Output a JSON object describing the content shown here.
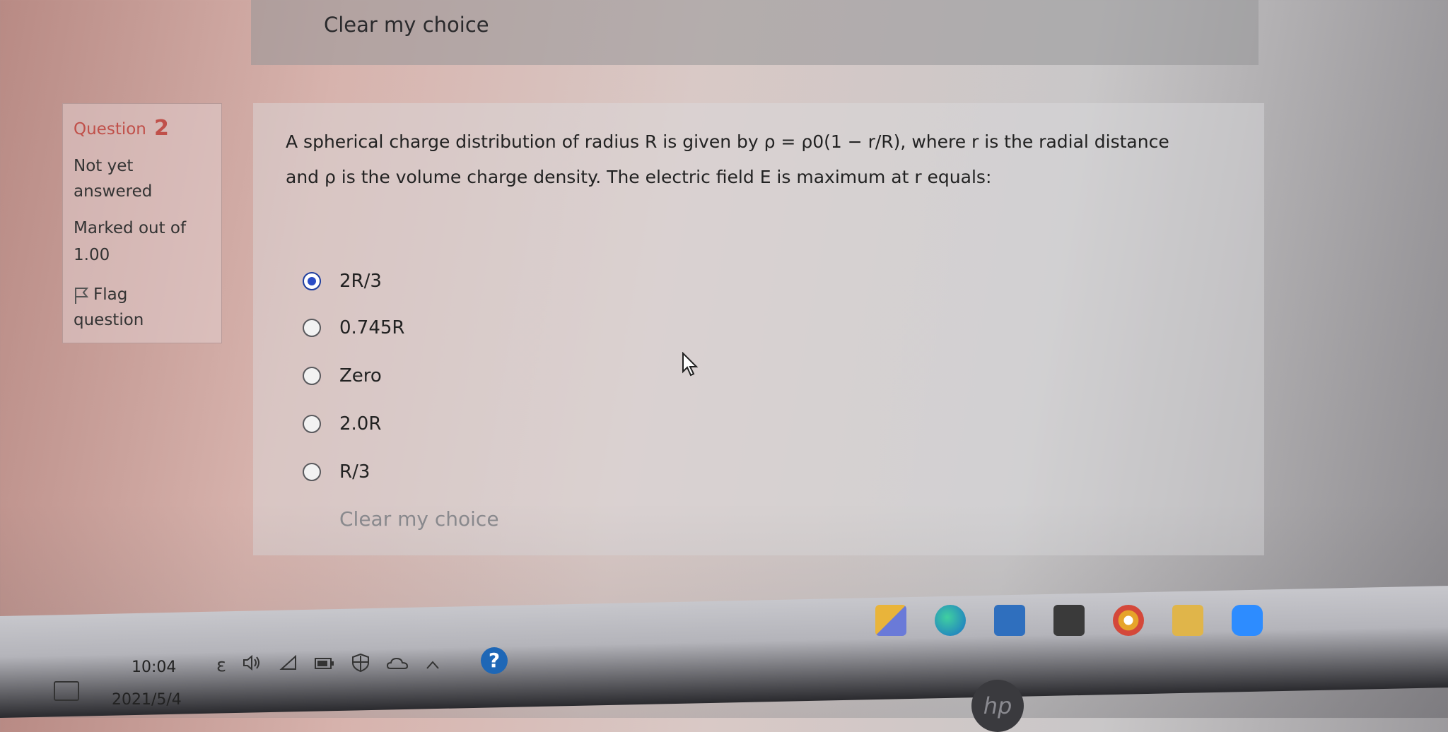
{
  "top": {
    "clear_label": "Clear my choice"
  },
  "info": {
    "question_label": "Question",
    "question_number": "2",
    "status_line1": "Not yet",
    "status_line2": "answered",
    "marked_line1": "Marked out of",
    "marked_line2": "1.00",
    "flag_line1": "Flag",
    "flag_line2": "question"
  },
  "question": {
    "text_line1": "A spherical charge distribution of radius R is given by  ρ = ρ0(1 − r/R), where r is the radial distance",
    "text_line2": "and ρ is the volume charge density.  The electric field E is maximum at r equals:"
  },
  "options": [
    {
      "label": "2R/3",
      "selected": true
    },
    {
      "label": "0.745R",
      "selected": false
    },
    {
      "label": "Zero",
      "selected": false
    },
    {
      "label": "2.0R",
      "selected": false
    },
    {
      "label": "R/3",
      "selected": false
    }
  ],
  "bottom": {
    "clear_label": "Clear my choice"
  },
  "taskbar": {
    "time": "10:04",
    "date": "2021/5/4",
    "ime_indicator": "ε",
    "tray_icons": [
      "speaker-icon",
      "wifi-icon",
      "battery-icon",
      "security-icon",
      "cloud-icon",
      "chevron-up-icon"
    ],
    "help_glyph": "?",
    "apps": [
      "windows-store-icon",
      "edge-icon",
      "mail-icon",
      "store-bag-icon",
      "chrome-icon",
      "file-explorer-icon",
      "zoom-icon"
    ],
    "brand": "hp"
  },
  "colors": {
    "accent_red": "#c0504a",
    "radio_selected": "#2a4cc6",
    "help_blue": "#1e67b6"
  }
}
